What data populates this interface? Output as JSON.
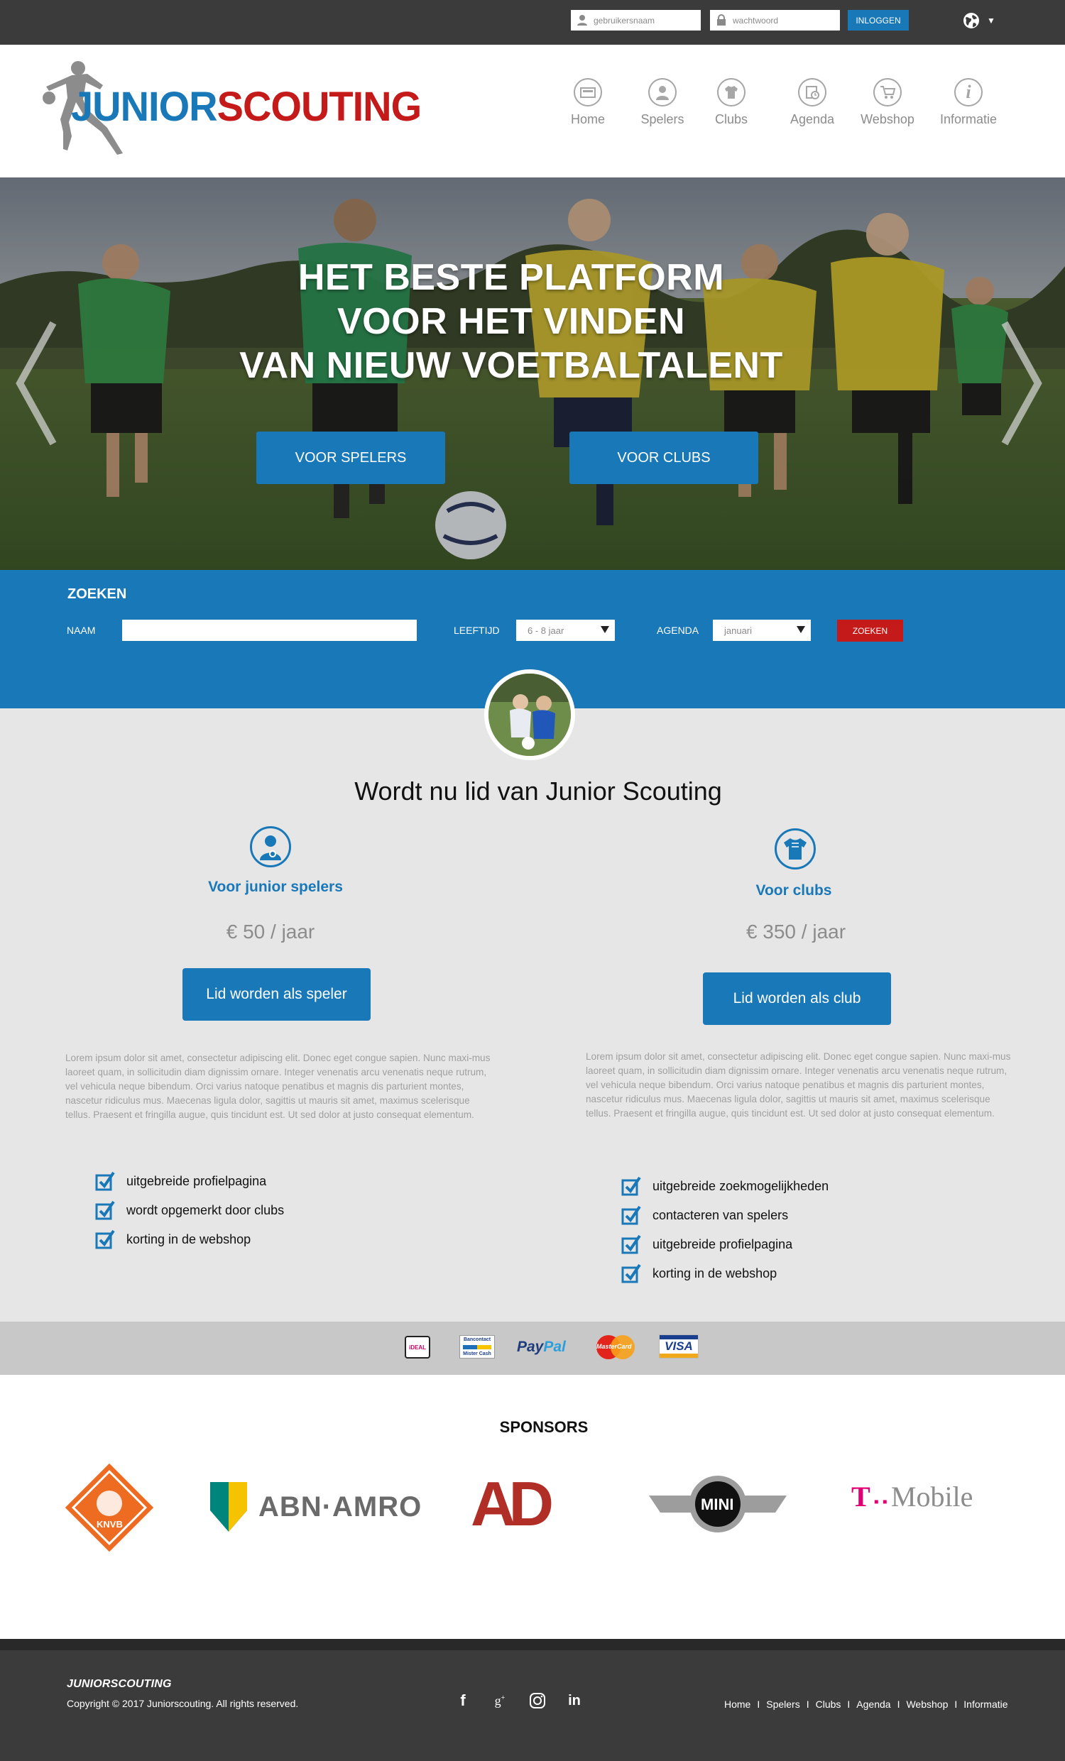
{
  "topbar": {
    "username_placeholder": "gebruikersnaam",
    "password_placeholder": "wachtwoord",
    "login_label": "INLOGGEN"
  },
  "header": {
    "logo_text_junior": "JUNIOR",
    "logo_text_scouting": "SCOUTING",
    "nav": [
      "Home",
      "Spelers",
      "Clubs",
      "Agenda",
      "Webshop",
      "Informatie"
    ]
  },
  "hero": {
    "title_line1": "HET BESTE PLATFORM",
    "title_line2": "VOOR HET VINDEN",
    "title_line3": "VAN NIEUW VOETBALTALENT",
    "btn_players": "VOOR SPELERS",
    "btn_clubs": "VOOR CLUBS"
  },
  "search": {
    "title": "ZOEKEN",
    "name_label": "NAAM",
    "age_label": "LEEFTIJD",
    "age_value": "6 - 8 jaar",
    "agenda_label": "AGENDA",
    "agenda_value": "januari",
    "submit_label": "ZOEKEN"
  },
  "membership": {
    "title": "Wordt nu lid van Junior Scouting",
    "players": {
      "heading": "Voor junior spelers",
      "price": "€ 50 / jaar",
      "button": "Lid worden als speler",
      "lorem": "Lorem ipsum dolor sit amet, consectetur adipiscing elit. Donec eget congue sapien. Nunc maxi-mus laoreet quam, in sollicitudin diam dignissim ornare. Integer venenatis arcu venenatis neque rutrum, vel vehicula neque bibendum. Orci varius natoque penatibus et magnis dis parturient montes, nascetur ridiculus mus. Maecenas ligula dolor, sagittis ut mauris sit amet, maximus scelerisque tellus. Praesent et fringilla augue, quis tincidunt est. Ut sed dolor at justo consequat elementum.",
      "features": [
        "uitgebreide profielpagina",
        "wordt opgemerkt door clubs",
        "korting in de webshop"
      ]
    },
    "clubs": {
      "heading": "Voor clubs",
      "price": "€ 350 / jaar",
      "button": "Lid worden als club",
      "lorem": "Lorem ipsum dolor sit amet, consectetur adipiscing elit. Donec eget congue sapien. Nunc maxi-mus laoreet quam, in sollicitudin diam dignissim ornare. Integer venenatis arcu venenatis neque rutrum, vel vehicula neque bibendum. Orci varius natoque penatibus et magnis dis parturient montes, nascetur ridiculus mus. Maecenas ligula dolor, sagittis ut mauris sit amet, maximus scelerisque tellus. Praesent et fringilla augue, quis tincidunt est. Ut sed dolor at justo consequat elementum.",
      "features": [
        "uitgebreide zoekmogelijkheden",
        "contacteren van spelers",
        "uitgebreide profielpagina",
        "korting in de webshop"
      ]
    }
  },
  "payments": {
    "ideal": "iDEAL",
    "bancontact_top": "Bancontact",
    "bancontact_bottom": "Mister Cash",
    "paypal_a": "Pay",
    "paypal_b": "Pal",
    "mastercard": "MasterCard",
    "visa": "VISA"
  },
  "sponsors": {
    "title": "SPONSORS",
    "knvb": "KNVB",
    "abn": "ABN·AMRO",
    "ad": "AD",
    "mini": "MINI",
    "tmobile_t": "T",
    "tmobile_rest": "Mobile"
  },
  "footer": {
    "brand": "JUNIORSCOUTING",
    "copyright": "Copyright © 2017 Juniorscouting. All rights reserved.",
    "nav": [
      "Home",
      "Spelers",
      "Clubs",
      "Agenda",
      "Webshop",
      "Informatie"
    ]
  },
  "colors": {
    "brand_blue": "#1978b8",
    "brand_red": "#c41a1a",
    "dark": "#3b3b3b"
  }
}
